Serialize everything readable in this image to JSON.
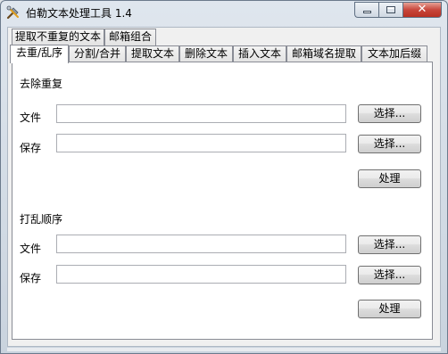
{
  "window": {
    "title": "伯勒文本处理工具 1.4",
    "app_icon": "tools-icon",
    "caption": {
      "minimize_icon": "minimize-icon",
      "maximize_icon": "maximize-icon",
      "close_icon": "close-icon",
      "close_glyph": "✕"
    }
  },
  "tabs": {
    "row1": [
      "提取不重复的文本",
      "邮箱组合"
    ],
    "row2": [
      "去重/乱序",
      "分割/合并",
      "提取文本",
      "删除文本",
      "插入文本",
      "邮箱域名提取",
      "文本加后缀"
    ],
    "active": "去重/乱序"
  },
  "dedupe": {
    "group_label": "去除重复",
    "file_label": "文件",
    "file_value": "",
    "save_label": "保存",
    "save_value": "",
    "browse_label": "选择...",
    "process_label": "处理"
  },
  "shuffle": {
    "group_label": "打乱顺序",
    "file_label": "文件",
    "file_value": "",
    "save_label": "保存",
    "save_value": "",
    "browse_label": "选择...",
    "process_label": "处理"
  },
  "colors": {
    "close_button": "#c8463b",
    "panel_bg": "#ffffff",
    "frame": "#dfe6ee"
  }
}
